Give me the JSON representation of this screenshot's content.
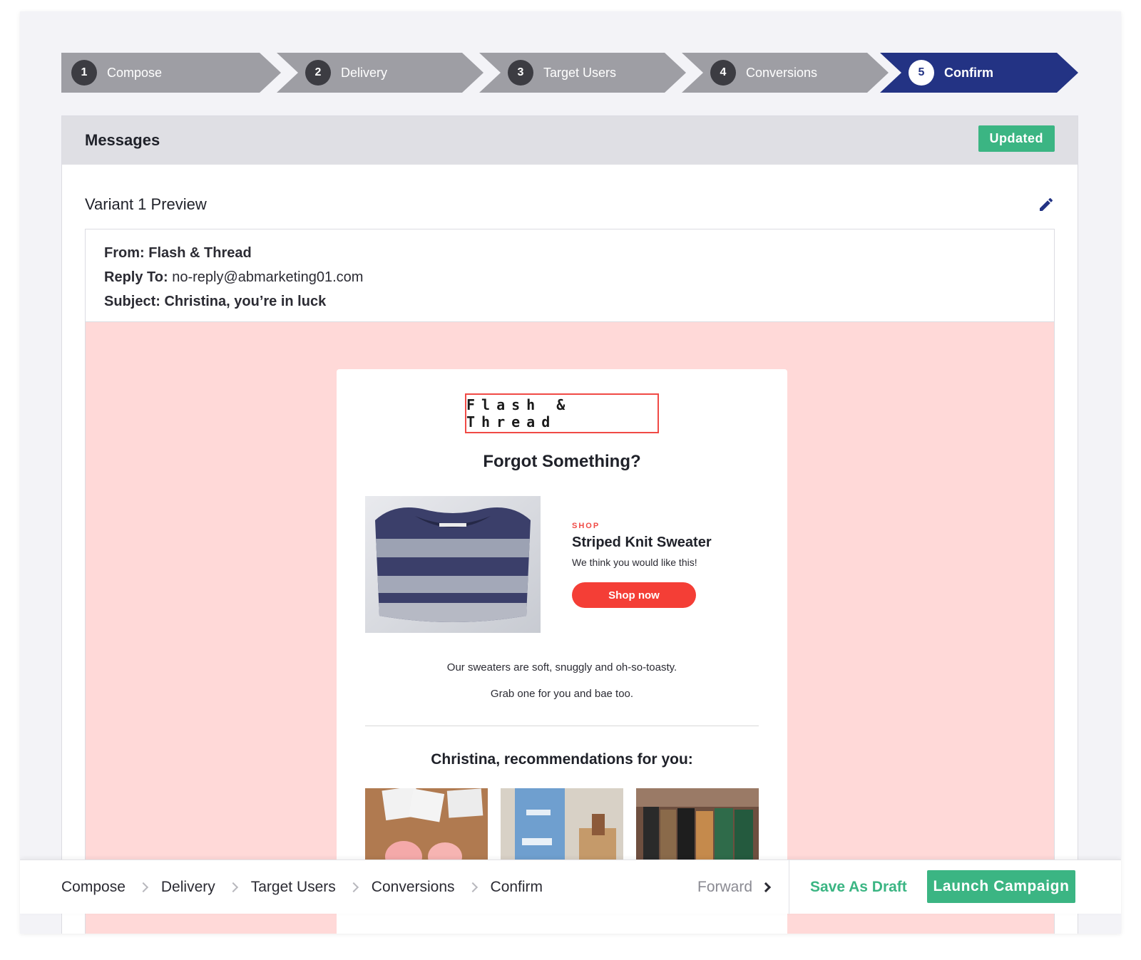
{
  "stepper": {
    "steps": [
      {
        "num": "1",
        "label": "Compose"
      },
      {
        "num": "2",
        "label": "Delivery"
      },
      {
        "num": "3",
        "label": "Target Users"
      },
      {
        "num": "4",
        "label": "Conversions"
      },
      {
        "num": "5",
        "label": "Confirm"
      }
    ],
    "active_step": "5"
  },
  "messages": {
    "title": "Messages",
    "status_badge": "Updated",
    "variant_title": "Variant 1 Preview",
    "edit_icon": "pencil-icon"
  },
  "email_meta": {
    "from_label": "From:",
    "from_value": "Flash & Thread",
    "reply_label": "Reply To:",
    "reply_value": "no-reply@abmarketing01.com",
    "subject_label": "Subject:",
    "subject_value": "Christina, you’re in luck"
  },
  "email": {
    "brand": "Flash & Thread",
    "headline": "Forgot Something?",
    "product": {
      "tag": "SHOP",
      "name": "Striped Knit Sweater",
      "description": "We think you would like this!",
      "button": "Shop now"
    },
    "body_line_1": "Our sweaters are soft, snuggly and oh-so-toasty.",
    "body_line_2": "Grab one for you and bae too.",
    "recs_title": "Christina, recommendations for you:"
  },
  "bottom_bar": {
    "crumbs": [
      "Compose",
      "Delivery",
      "Target Users",
      "Conversions",
      "Confirm"
    ],
    "forward": "Forward",
    "save_draft": "Save As Draft",
    "launch": "Launch Campaign"
  },
  "colors": {
    "active_step": "#233384",
    "inactive_step": "#9e9ea4",
    "success": "#3bb583",
    "email_bg": "#ffd9d8",
    "cta_red": "#f43e36"
  }
}
